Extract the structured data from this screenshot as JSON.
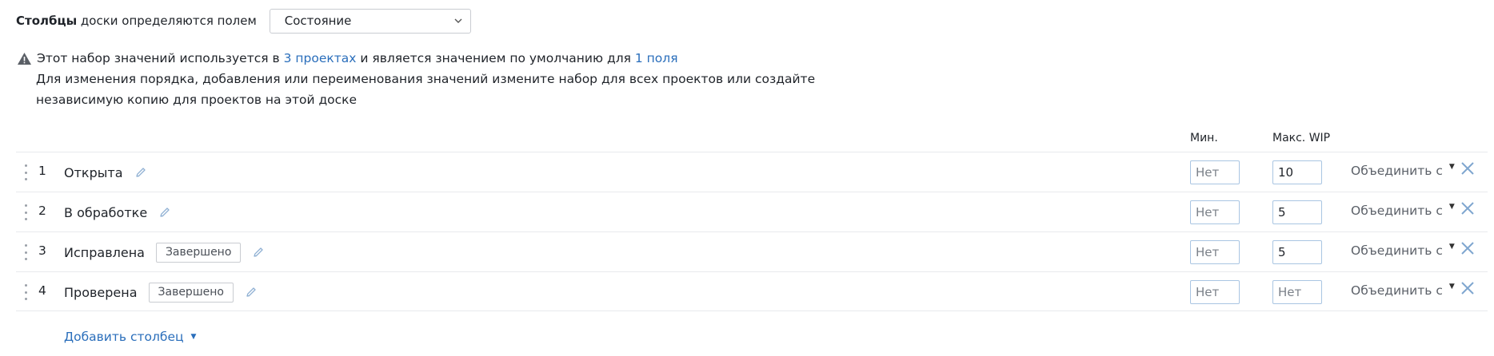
{
  "header": {
    "label_bold": "Столбцы",
    "label_rest": " доски определяются полем",
    "select_value": "Состояние"
  },
  "info": {
    "part1": "Этот набор значений используется в ",
    "link1": "3 проектах",
    "part2": " и является значением по умолчанию для ",
    "link2": "1 поля",
    "line2": "Для изменения порядка, добавления или переименования значений измените набор для всех проектов или создайте",
    "line3": "независимую копию для проектов на этой доске"
  },
  "columns": {
    "min_header": "Мин.",
    "max_header": "Макс. WIP"
  },
  "rows": [
    {
      "num": "1",
      "name": "Открыта",
      "badge": "",
      "min_placeholder": "Нет",
      "max_value": "10",
      "max_placeholder": "",
      "merge": "Объединить с"
    },
    {
      "num": "2",
      "name": "В обработке",
      "badge": "",
      "min_placeholder": "Нет",
      "max_value": "5",
      "max_placeholder": "",
      "merge": "Объединить с"
    },
    {
      "num": "3",
      "name": "Исправлена",
      "badge": "Завершено",
      "min_placeholder": "Нет",
      "max_value": "5",
      "max_placeholder": "",
      "merge": "Объединить с"
    },
    {
      "num": "4",
      "name": "Проверена",
      "badge": "Завершено",
      "min_placeholder": "Нет",
      "max_value": "",
      "max_placeholder": "Нет",
      "merge": "Объединить с"
    }
  ],
  "add_column": "Добавить столбец",
  "icons": {
    "select": "chevron-down-icon",
    "warning": "warning-icon",
    "edit": "pencil-icon",
    "remove": "close-icon",
    "drag": "drag-handle-icon"
  },
  "colors": {
    "link": "#2a6ebb",
    "input_border": "#a9c5e2",
    "close": "#7fa6cf",
    "pencil": "#8fb0d3"
  }
}
